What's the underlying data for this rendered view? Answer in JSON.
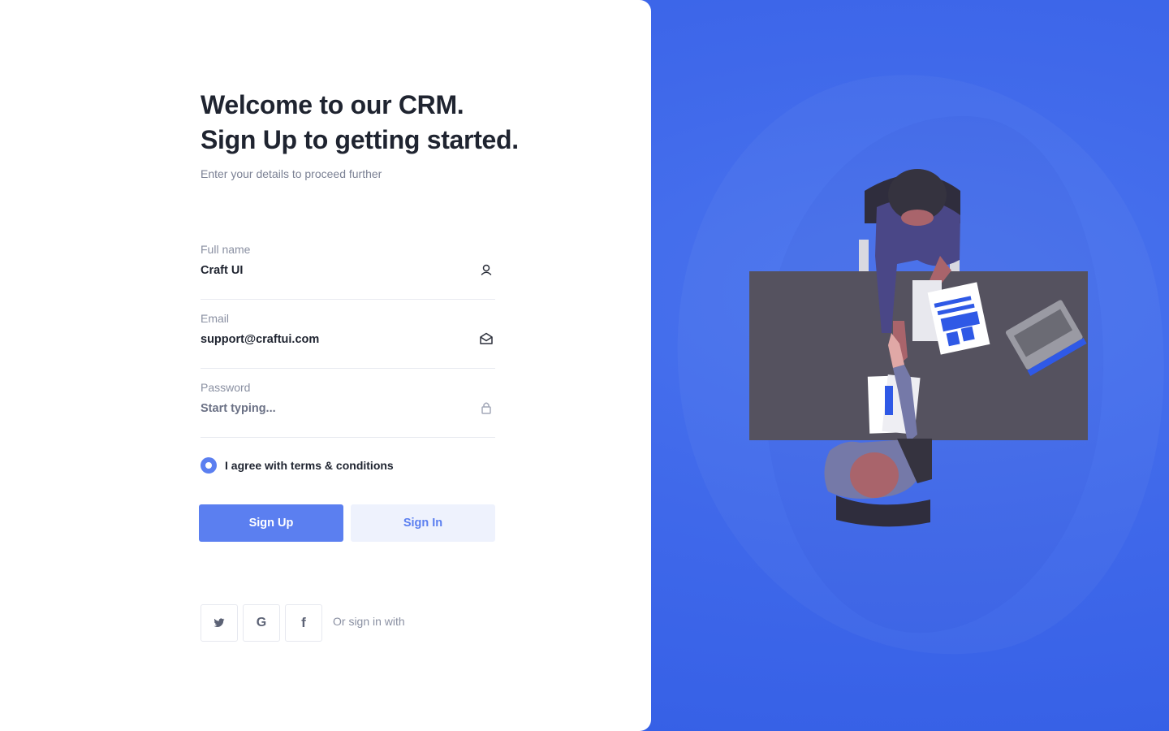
{
  "hero": {
    "title_line1": "Welcome to our CRM.",
    "title_line2": "Sign Up to getting started.",
    "subtitle": "Enter your details to proceed further"
  },
  "form": {
    "full_name": {
      "label": "Full name",
      "value": "Craft UI",
      "icon": "user-icon"
    },
    "email": {
      "label": "Email",
      "value": "support@craftui.com",
      "icon": "mail-icon"
    },
    "password": {
      "label": "Password",
      "placeholder": "Start typing...",
      "icon": "lock-icon"
    },
    "terms": {
      "label": "I agree with terms & conditions",
      "checked": true
    }
  },
  "actions": {
    "sign_up": "Sign Up",
    "sign_in": "Sign In"
  },
  "social": {
    "label": "Or sign in with",
    "providers": [
      {
        "name": "twitter",
        "glyph": "",
        "icon": "twitter-icon"
      },
      {
        "name": "google",
        "glyph": "G",
        "icon": "google-icon"
      },
      {
        "name": "facebook",
        "glyph": "f",
        "icon": "facebook-icon"
      }
    ]
  },
  "colors": {
    "accent": "#5b7ff0",
    "accent_light": "#eef2fd",
    "right_panel": "#3a63e8",
    "text_dark": "#1f2430",
    "text_muted": "#8a90a2"
  }
}
